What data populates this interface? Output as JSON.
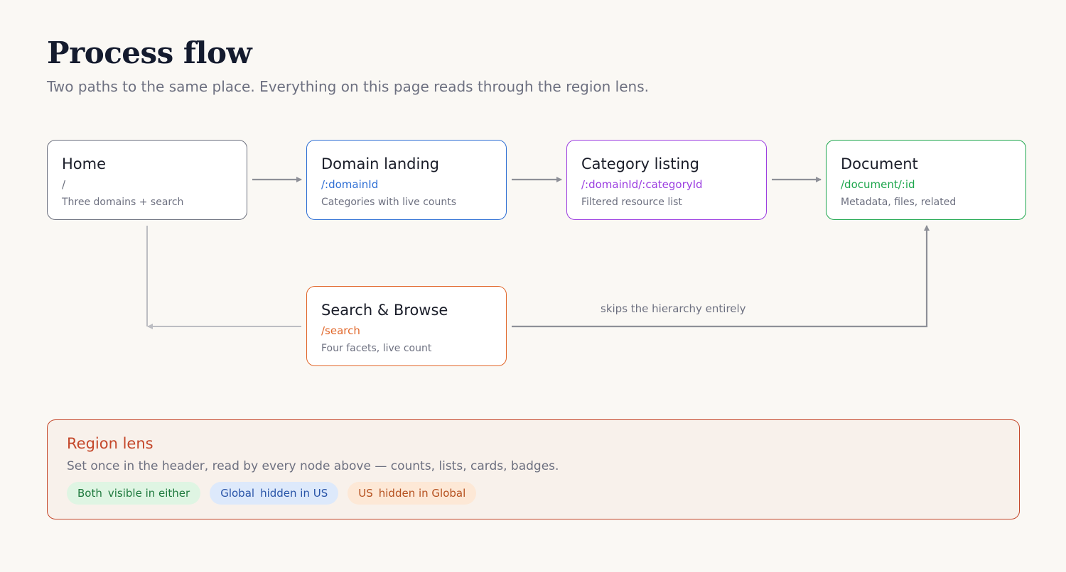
{
  "header": {
    "title": "Process flow",
    "subtitle": "Two paths to the same place. Everything on this page reads through the region lens."
  },
  "nodes": {
    "home": {
      "title": "Home",
      "route": "/",
      "description": "Three domains + search",
      "color": "#6b6f7d"
    },
    "domain": {
      "title": "Domain landing",
      "route": "/:domainId",
      "description": "Categories with live counts",
      "color": "#2f6fd4"
    },
    "category": {
      "title": "Category listing",
      "route": "/:domainId/:categoryId",
      "description": "Filtered resource list",
      "color": "#9b3de0"
    },
    "document": {
      "title": "Document",
      "route": "/document/:id",
      "description": "Metadata, files, related",
      "color": "#1ea64d"
    },
    "search": {
      "title": "Search & Browse",
      "route": "/search",
      "description": "Four facets, live count",
      "color": "#e1672a"
    }
  },
  "edges": {
    "skip_label": "skips the hierarchy entirely"
  },
  "lens": {
    "title": "Region lens",
    "description": "Set once in the header, read by every node above — counts, lists, cards, badges.",
    "color": "#c4472a",
    "chips": [
      {
        "key": "Both",
        "label": "visible in either"
      },
      {
        "key": "Global",
        "label": "hidden in US"
      },
      {
        "key": "US",
        "label": "hidden in Global"
      }
    ]
  }
}
